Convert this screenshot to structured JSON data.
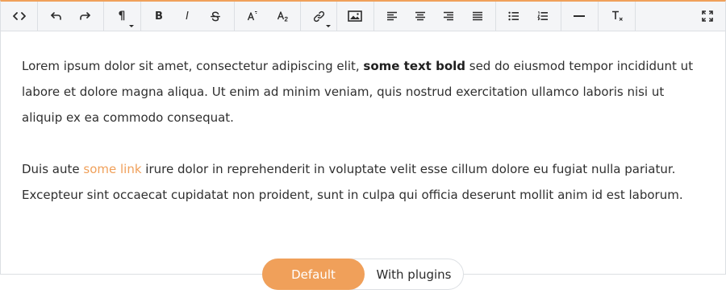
{
  "toolbar": {
    "buttons": [
      {
        "name": "code-view-icon"
      },
      {
        "name": "undo-icon"
      },
      {
        "name": "redo-icon"
      },
      {
        "name": "paragraph-format-icon",
        "glyph": "¶"
      },
      {
        "name": "bold-icon",
        "glyph": "B"
      },
      {
        "name": "italic-icon",
        "glyph": "I"
      },
      {
        "name": "strikethrough-icon"
      },
      {
        "name": "superscript-icon",
        "glyph": "A",
        "sub": "2"
      },
      {
        "name": "subscript-icon",
        "glyph": "A",
        "sub": "2"
      },
      {
        "name": "link-icon"
      },
      {
        "name": "image-icon"
      },
      {
        "name": "align-left-icon"
      },
      {
        "name": "align-center-icon"
      },
      {
        "name": "align-right-icon"
      },
      {
        "name": "align-justify-icon"
      },
      {
        "name": "unordered-list-icon"
      },
      {
        "name": "ordered-list-icon"
      },
      {
        "name": "horizontal-rule-icon"
      },
      {
        "name": "clear-formatting-icon",
        "glyph": "T",
        "sub": "x"
      },
      {
        "name": "fullscreen-icon"
      }
    ]
  },
  "content": {
    "p1_before": "Lorem ipsum dolor sit amet, consectetur adipiscing elit, ",
    "p1_bold": "some text bold",
    "p1_after": " sed do eiusmod tempor incididunt ut labore et dolore magna aliqua. Ut enim ad minim veniam, quis nostrud exercitation ullamco laboris nisi ut aliquip ex ea commodo consequat.",
    "p2_before": "Duis aute ",
    "p2_link": "some link",
    "p2_after": " irure dolor in reprehenderit in voluptate velit esse cillum dolore eu fugiat nulla pariatur. Excepteur sint occaecat cupidatat non proident, sunt in culpa qui officia deserunt mollit anim id est laborum."
  },
  "toggle": {
    "default_label": "Default",
    "plugins_label": "With plugins",
    "selected": "Default"
  },
  "colors": {
    "accent": "#f0a05a",
    "toolbar_bg": "#f4f5f7",
    "border": "#dcdfe3",
    "text": "#2f2f2f"
  }
}
